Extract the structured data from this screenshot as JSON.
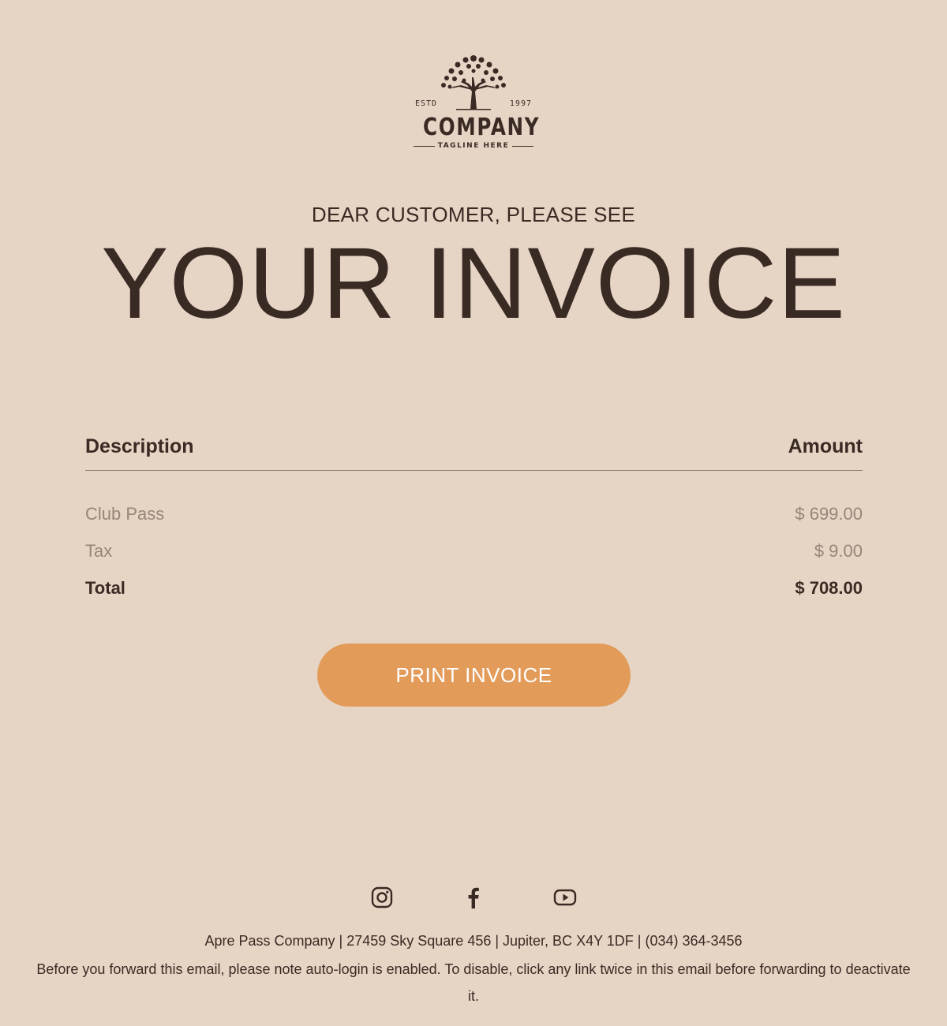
{
  "logo": {
    "estd": "ESTD",
    "year": "1997",
    "company": "COMPANY",
    "tagline": "TAGLINE HERE"
  },
  "greeting": "DEAR CUSTOMER, PLEASE SEE",
  "headline": "YOUR INVOICE",
  "table": {
    "headers": {
      "description": "Description",
      "amount": "Amount"
    },
    "rows": [
      {
        "description": "Club Pass",
        "amount": "$ 699.00"
      },
      {
        "description": "Tax",
        "amount": "$ 9.00"
      }
    ],
    "total": {
      "description": "Total",
      "amount": "$ 708.00"
    }
  },
  "print_button": "PRINT INVOICE",
  "social": [
    "instagram-icon",
    "facebook-icon",
    "youtube-icon"
  ],
  "footer": {
    "address": "Apre Pass Company | 27459 Sky Square 456 | Jupiter, BC X4Y 1DF | (034) 364-3456",
    "note": "Before you forward this email, please note auto-login is enabled. To disable, click any link twice in this email before forwarding to deactivate it."
  },
  "colors": {
    "background": "#e6d5c5",
    "text": "#3a2a24",
    "muted": "#958679",
    "accent": "#e39b5a"
  }
}
